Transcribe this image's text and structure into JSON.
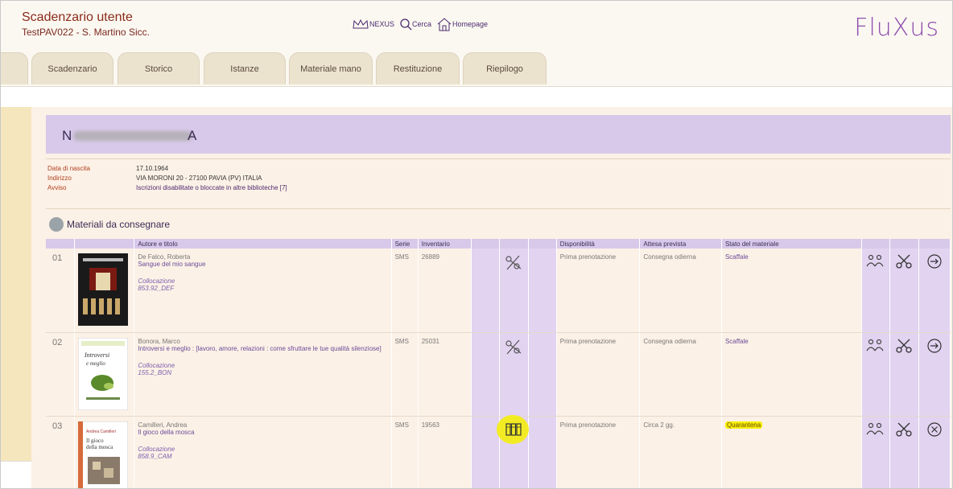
{
  "header": {
    "title": "Scadenzario utente",
    "subtitle": "TestPAV022 - S. Martino Sicc.",
    "nav": [
      {
        "icon": "crown-icon",
        "label": "NEXUS"
      },
      {
        "icon": "search-icon",
        "label": "Cerca"
      },
      {
        "icon": "home-icon",
        "label": "Homepage"
      }
    ],
    "logo": "FluXus"
  },
  "tabs": [
    "Scadenzario",
    "Storico",
    "Istanze",
    "Materiale mano",
    "Restituzione",
    "Riepilogo"
  ],
  "user": {
    "name_start": "N",
    "name_end": "A"
  },
  "info": [
    {
      "label": "Data di nascita",
      "value": "17.10.1964"
    },
    {
      "label": "Indirizzo",
      "value": "VIA MORONI 20 - 27100 PAVIA (PV) ITALIA"
    },
    {
      "label": "Avviso",
      "value": "Iscrizioni disabilitate o bloccate in altre biblioteche [7]"
    }
  ],
  "section_title": "Materiali da consegnare",
  "table": {
    "headers": {
      "author": "Autore e titolo",
      "serie": "Serie",
      "inventario": "Inventario",
      "disponibilita": "Disponibilità",
      "attesa": "Attesa prevista",
      "stato": "Stato del materiale"
    },
    "collocazione_label": "Collocazione",
    "rows": [
      {
        "num": "01",
        "author": "De Falco, Roberta",
        "title": "Sangue del mio sangue",
        "collocazione": "853.92_DEF",
        "serie": "SMS",
        "inventario": "26889",
        "disponibilita": "Prima prenotazione",
        "attesa": "Consegna odierna",
        "stato": "Scaffale",
        "status_icon": "scissors-icon",
        "action_icon": "arrow-right-circle-icon"
      },
      {
        "num": "02",
        "author": "Bonora, Marco",
        "title": "Introversi e meglio : [lavoro, amore, relazioni : come sfruttare le tue qualità silenziose]",
        "collocazione": "155.2_BON",
        "serie": "SMS",
        "inventario": "25031",
        "disponibilita": "Prima prenotazione",
        "attesa": "Consegna odierna",
        "stato": "Scaffale",
        "status_icon": "scissors-icon",
        "action_icon": "arrow-right-circle-icon"
      },
      {
        "num": "03",
        "author": "Camilleri, Andrea",
        "title": "Il gioco della mosca",
        "collocazione": "858.9_CAM",
        "serie": "SMS",
        "inventario": "19563",
        "disponibilita": "Prima prenotazione",
        "attesa": "Circa 2 gg.",
        "stato": "Quarantena",
        "status_icon": "books-icon",
        "action_icon": "x-circle-icon"
      }
    ]
  },
  "covers": [
    {
      "text": "Sangue del mio sangue"
    },
    {
      "text": "Introversi e meglio"
    },
    {
      "text": "Il gioco della mosca"
    }
  ],
  "colors": {
    "accent": "#8f4fb0",
    "header_bar": "#d8c9ea",
    "highlight": "#f7f000"
  }
}
